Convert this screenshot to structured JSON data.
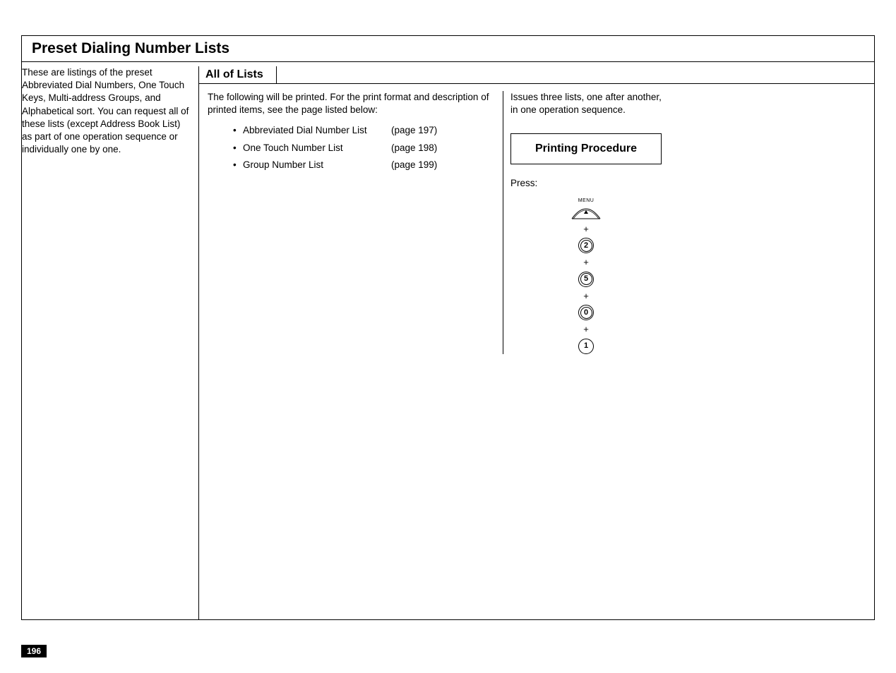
{
  "header": {
    "title": "Preset Dialing Number Lists"
  },
  "left": {
    "intro": "These are listings of the preset Abbreviated Dial Numbers, One Touch Keys, Multi-address Groups, and Alphabetical sort. You can request all of these lists (except Address Book List) as part of one operation sequence or individually one by one."
  },
  "sub": {
    "title": "All of Lists"
  },
  "mid": {
    "intro": "The following will be printed.  For the print format and description of printed items, see the page listed below:",
    "items": [
      {
        "name": "Abbreviated Dial Number List",
        "page": "(page 197)"
      },
      {
        "name": "One Touch Number List",
        "page": "(page 198)"
      },
      {
        "name": "Group Number List",
        "page": "(page 199)"
      }
    ]
  },
  "right": {
    "intro": "Issues three lists, one after another, in one operation sequence.",
    "procTitle": "Printing Procedure",
    "pressLabel": "Press:",
    "menuLabel": "MENU",
    "keys": [
      "2",
      "5",
      "0",
      "1"
    ]
  },
  "pageNumber": "196"
}
